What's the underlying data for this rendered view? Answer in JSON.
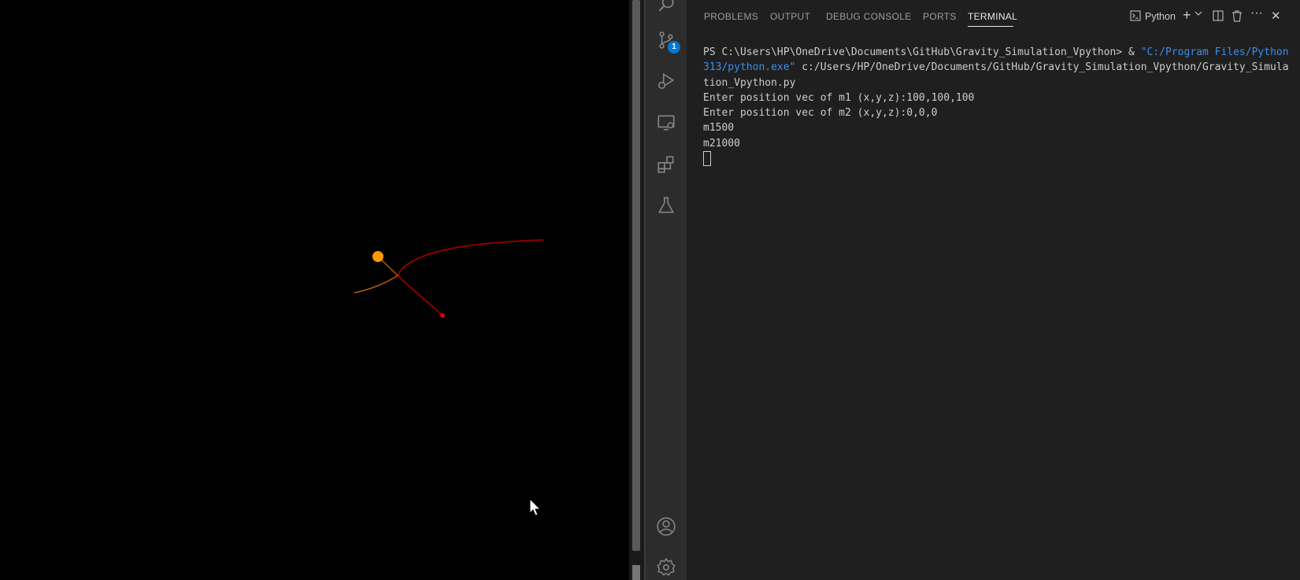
{
  "terminal": {
    "tabs": [
      "PROBLEMS",
      "OUTPUT",
      "DEBUG CONSOLE",
      "PORTS",
      "TERMINAL"
    ],
    "active_tab": "TERMINAL",
    "profile_label": "Python",
    "prompt": "PS C:\\Users\\HP\\OneDrive\\Documents\\GitHub\\Gravity_Simulation_Vpython> & ",
    "exe_path": "\"C:/Program Files/Python313/python.exe\"",
    "script_path": " c:/Users/HP/OneDrive/Documents/GitHub/Gravity_Simulation_Vpython/Gravity_Simulation_Vpython.py",
    "line_m1": "Enter position vec of m1 (x,y,z):100,100,100",
    "line_m2": "Enter position vec of m2 (x,y,z):0,0,0",
    "line_mass1": "m1500",
    "line_mass2": "m21000"
  },
  "activity_bar": {
    "source_control_badge": "1",
    "icons": [
      "search-icon",
      "source-control-icon",
      "run-debug-icon",
      "remote-explorer-icon",
      "extensions-icon",
      "testing-icon",
      "account-icon",
      "settings-gear-icon"
    ]
  },
  "simulation": {
    "body1_color": "#ff9900",
    "body2_color": "#e00000",
    "trail_color": "#8b0000"
  }
}
